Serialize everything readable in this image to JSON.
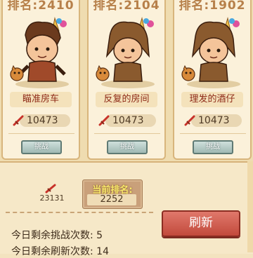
{
  "opponents": [
    {
      "rank_label": "排名:2410",
      "name": "瞄准房车",
      "power": "10473",
      "challenge_label": "挑战",
      "hair_color": "#6b3a1e"
    },
    {
      "rank_label": "排名:2104",
      "name": "反复的房间",
      "power": "10473",
      "challenge_label": "挑战",
      "hair_color": "#8a5a2e"
    },
    {
      "rank_label": "排名:1902",
      "name": "理发的酒仔",
      "power": "10473",
      "challenge_label": "挑战",
      "hair_color": "#8a5a2e"
    }
  ],
  "player": {
    "power": "23131",
    "rank_label": "当前排名:",
    "rank_value": "2252"
  },
  "status": {
    "attempts_text": "今日剩余挑战次数: 5",
    "refresh_text": "今日剩余刷新次数: 14"
  },
  "refresh_button_label": "刷新",
  "colors": {
    "accent_red": "#c24a3c",
    "challenge_button": "#9fb9b3",
    "rank_highlight": "#f8e86b"
  }
}
